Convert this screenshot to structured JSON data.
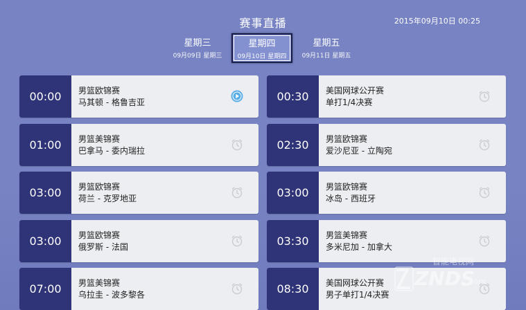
{
  "header": {
    "title": "赛事直播",
    "datetime": "2015年09月10日 00:25"
  },
  "days": [
    {
      "weekday": "星期三",
      "date": "09月09日 星期三",
      "active": false
    },
    {
      "weekday": "星期四",
      "date": "09月10日 星期四",
      "active": true
    },
    {
      "weekday": "星期五",
      "date": "09月11日 星期五",
      "active": false
    }
  ],
  "events": [
    {
      "time": "00:00",
      "league": "男篮欧锦赛",
      "match": "马其顿 - 格鲁吉亚",
      "icon": "play-icon"
    },
    {
      "time": "00:30",
      "league": "美国网球公开赛",
      "match": "单打1/4决赛",
      "icon": "alarm-clock-icon"
    },
    {
      "time": "01:00",
      "league": "男篮美锦赛",
      "match": "巴拿马 - 委内瑞拉",
      "icon": "alarm-clock-icon"
    },
    {
      "time": "02:30",
      "league": "男篮欧锦赛",
      "match": "爱沙尼亚 - 立陶宛",
      "icon": "alarm-clock-icon"
    },
    {
      "time": "03:00",
      "league": "男篮欧锦赛",
      "match": "荷兰 - 克罗地亚",
      "icon": "alarm-clock-icon"
    },
    {
      "time": "03:00",
      "league": "男篮欧锦赛",
      "match": "冰岛 - 西班牙",
      "icon": "alarm-clock-icon"
    },
    {
      "time": "03:00",
      "league": "男篮欧锦赛",
      "match": "俄罗斯 - 法国",
      "icon": "alarm-clock-icon"
    },
    {
      "time": "03:30",
      "league": "男篮美锦赛",
      "match": "多米尼加 - 加拿大",
      "icon": "alarm-clock-icon"
    },
    {
      "time": "07:00",
      "league": "男篮美锦赛",
      "match": "乌拉圭 - 波多黎各",
      "icon": "alarm-clock-icon"
    },
    {
      "time": "08:30",
      "league": "美国网球公开赛",
      "match": "男子单打1/4决赛",
      "icon": "alarm-clock-icon"
    }
  ],
  "watermark": {
    "brand": "ZNDS",
    "tagline": "智能电视网",
    "suffix": ".com"
  },
  "colors": {
    "background": "#7783c2",
    "time_block": "#2f3377",
    "card": "#eceef2",
    "play_icon": "#5aaee8",
    "alarm_icon": "#c9ccd2"
  }
}
